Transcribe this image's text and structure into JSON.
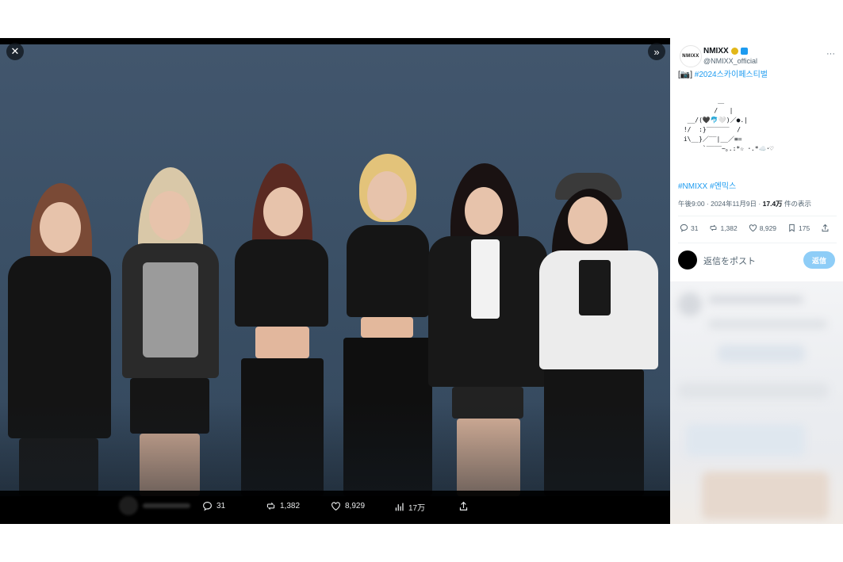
{
  "viewer": {
    "close_icon": "close-icon",
    "next_icon": "double-chevron-right-icon"
  },
  "media_actions": {
    "replies": "31",
    "reposts": "1,382",
    "likes": "8,929",
    "views": "17万"
  },
  "tweet": {
    "display_name": "NMIXX",
    "handle": "@NMIXX_official",
    "avatar_text": "NMIXX",
    "headline_prefix": "[📷]",
    "headline_tag": "#2024스카이페스티벌",
    "ascii_art": "          ＿\n         /   |\n  __/(🖤🐬🤍)／●.|\n !/  :}‾‾‾‾‾‾  /\n i\\__}／‾‾|__／≡=\n      `‾‾‾‾~｡.:*☆ ･.*☁️･♡",
    "hashtags": "#NMIXX #엔믹스",
    "time": "午後9:00 · 2024年11月9日 · ",
    "views_count": "17.4万",
    "views_suffix": " 件の表示",
    "stats": {
      "replies": "31",
      "reposts": "1,382",
      "likes": "8,929",
      "bookmarks": "175"
    },
    "reply_placeholder": "返信をポスト",
    "reply_button": "返信"
  },
  "colors": {
    "accent": "#1d9bf0",
    "verified_gold": "#e2b719",
    "reply_button": "#8ecdf7"
  }
}
